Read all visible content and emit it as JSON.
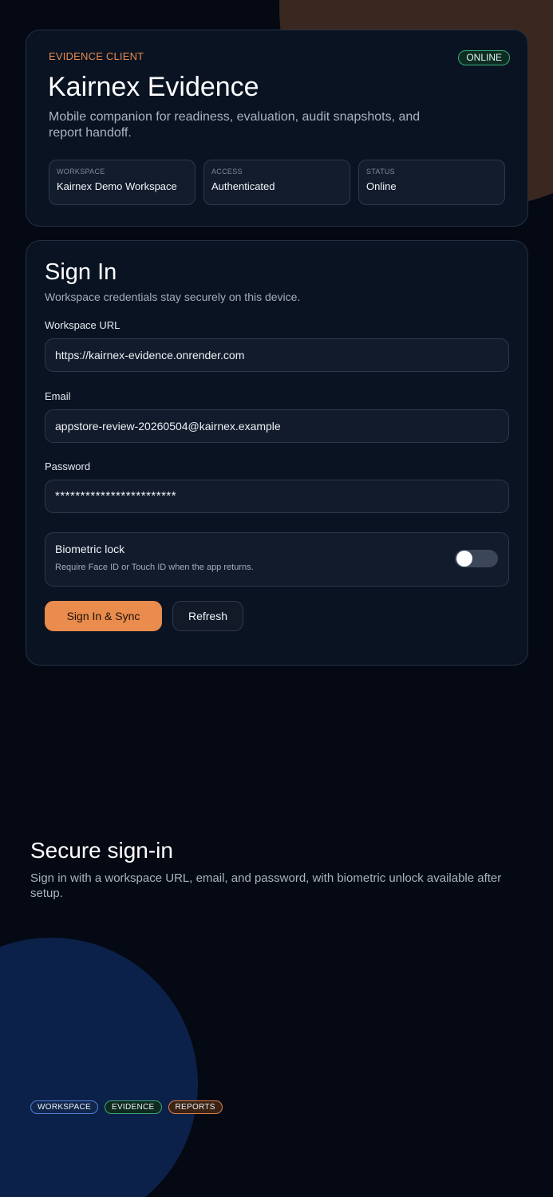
{
  "colors": {
    "background": "#040913",
    "accent": "#ea8c4d",
    "online_green": "#35b07a",
    "card": "#0a1322"
  },
  "hero": {
    "eyebrow": "EVIDENCE CLIENT",
    "status_pill": "ONLINE",
    "title": "Kairnex Evidence",
    "subtitle": "Mobile companion for readiness, evaluation, audit snapshots, and report handoff.",
    "tiles": [
      {
        "label": "WORKSPACE",
        "value": "Kairnex Demo Workspace"
      },
      {
        "label": "ACCESS",
        "value": "Authenticated"
      },
      {
        "label": "STATUS",
        "value": "Online"
      }
    ]
  },
  "signin": {
    "title": "Sign In",
    "subtitle": "Workspace credentials stay securely on this device.",
    "workspace_url_label": "Workspace URL",
    "workspace_url_value": "https://kairnex-evidence.onrender.com",
    "email_label": "Email",
    "email_value": "appstore-review-20260504@kairnex.example",
    "password_label": "Password",
    "password_value": "************************",
    "biometric": {
      "title": "Biometric lock",
      "description": "Require Face ID or Touch ID when the app returns.",
      "enabled": false
    },
    "primary_button": "Sign In & Sync",
    "secondary_button": "Refresh"
  },
  "feature": {
    "title": "Secure sign-in",
    "description": "Sign in with a workspace URL, email, and password, with biometric unlock available after setup."
  },
  "chips": [
    "WORKSPACE",
    "EVIDENCE",
    "REPORTS"
  ]
}
